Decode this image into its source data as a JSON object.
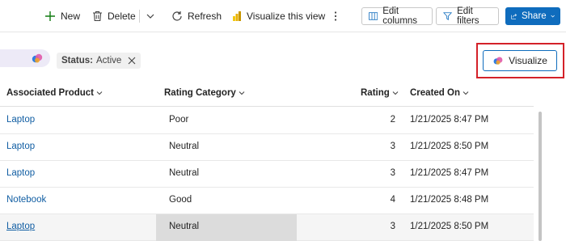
{
  "toolbar": {
    "new_label": "New",
    "delete_label": "Delete",
    "refresh_label": "Refresh",
    "visualize_view_label": "Visualize this view",
    "edit_columns_label": "Edit columns",
    "edit_filters_label": "Edit filters",
    "share_label": "Share"
  },
  "filters": {
    "status_key": "Status:",
    "status_value": "Active",
    "visualize_label": "Visualize"
  },
  "grid": {
    "columns": [
      "Associated Product",
      "Rating Category",
      "Rating",
      "Created On"
    ],
    "rows": [
      {
        "product": "Laptop",
        "category": "Poor",
        "rating": "2",
        "created": "1/21/2025 8:47 PM"
      },
      {
        "product": "Laptop",
        "category": "Neutral",
        "rating": "3",
        "created": "1/21/2025 8:50 PM"
      },
      {
        "product": "Laptop",
        "category": "Neutral",
        "rating": "3",
        "created": "1/21/2025 8:47 PM"
      },
      {
        "product": "Notebook",
        "category": "Good",
        "rating": "4",
        "created": "1/21/2025 8:48 PM"
      },
      {
        "product": "Laptop",
        "category": "Neutral",
        "rating": "3",
        "created": "1/21/2025 8:50 PM"
      }
    ]
  },
  "colors": {
    "accent": "#0f6cbd",
    "link": "#115ea3",
    "highlight_border": "#d42129"
  }
}
